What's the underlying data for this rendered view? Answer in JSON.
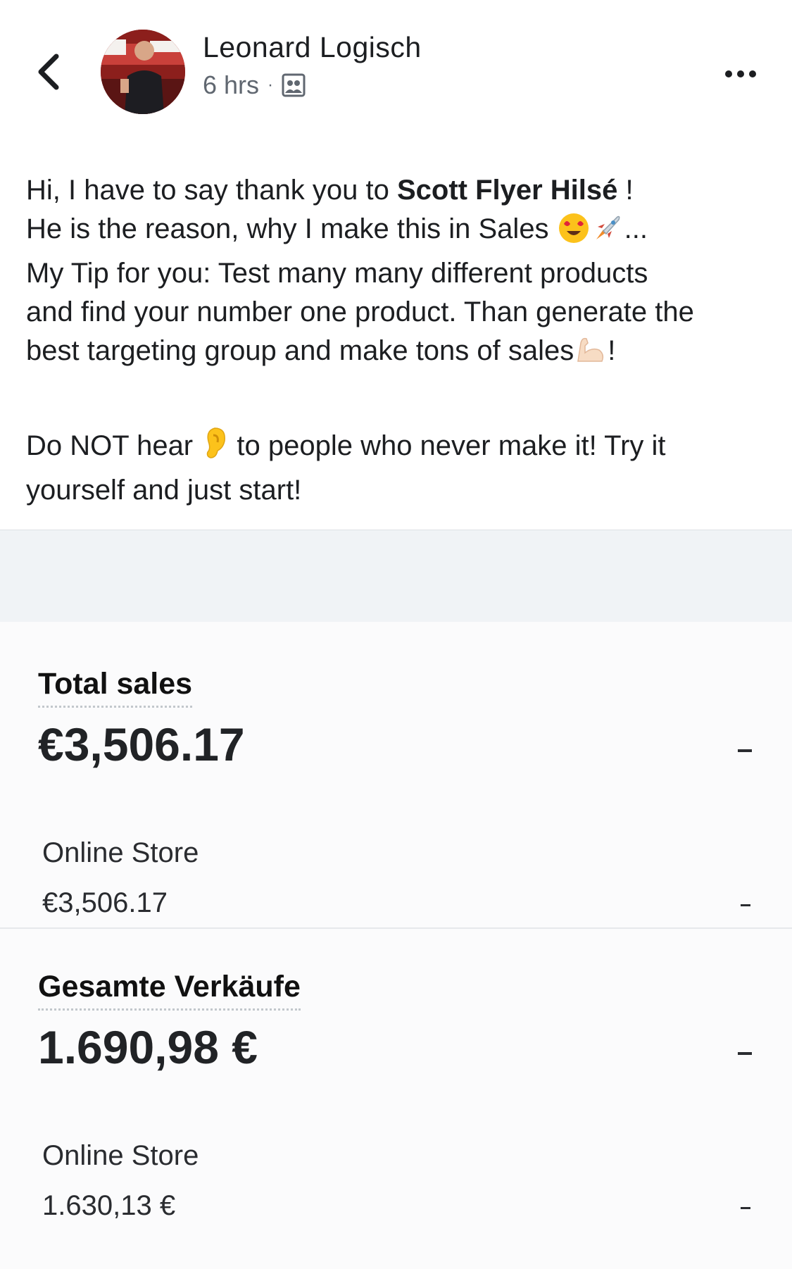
{
  "header": {
    "author": "Leonard Logisch",
    "time": "6 hrs",
    "separator": "·",
    "audience_icon": "friends-audience-icon",
    "back_icon": "chevron-left-icon",
    "more_icon": "more-horizontal-icon"
  },
  "post": {
    "line1_pre": "Hi, I have to say thank you to ",
    "line1_bold": "Scott Flyer Hilsé",
    "line1_post": " !",
    "line2_pre": "He is the reason, why I make this in Sales ",
    "line2_post": "...",
    "line3": "My Tip for you: Test many many different products",
    "line4": "and find your number one product. Than generate the",
    "line5_pre": "best targeting group and make tons of sales",
    "line5_post": "!",
    "line6_pre": "Do NOT hear ",
    "line6_post": " to people who never make it! Try it",
    "line7": "yourself and just start!",
    "emojis": [
      "heart-eyes-emoji",
      "rocket-emoji",
      "flexed-biceps-emoji",
      "ear-emoji"
    ]
  },
  "cards": [
    {
      "title": "Total sales",
      "value": "€3,506.17",
      "row_label": "Online Store",
      "row_value": "€3,506.17",
      "trend": "-",
      "row_trend": "-"
    },
    {
      "title": "Gesamte Verkäufe",
      "value": "1.690,98 €",
      "row_label": "Online Store",
      "row_value": "1.630,13 €",
      "trend": "-",
      "row_trend": "-"
    }
  ],
  "colors": {
    "text": "#1c1e21",
    "meta": "#606770",
    "banner": "#f0f3f6",
    "card_bg": "#fbfbfc"
  }
}
